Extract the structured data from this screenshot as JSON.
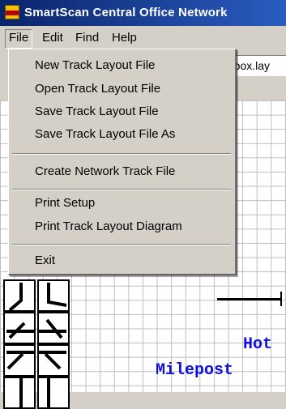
{
  "window": {
    "title": "SmartScan Central Office Network"
  },
  "menubar": {
    "file": "File",
    "edit": "Edit",
    "find": "Find",
    "help": "Help"
  },
  "file_menu": {
    "new_track": "New Track Layout File",
    "open_track": "Open Track Layout File",
    "save_track": "Save Track Layout File",
    "save_track_as": "Save Track Layout File As",
    "create_network": "Create Network Track File",
    "print_setup": "Print Setup",
    "print_diagram": "Print Track Layout Diagram",
    "exit": "Exit"
  },
  "toolbar": {
    "filename": "otbox.lay"
  },
  "canvas": {
    "hot_label": "Hot",
    "milepost_label": "Milepost"
  },
  "colors": {
    "title_bar": "#0a246a",
    "label_blue": "#1010e0",
    "menu_bg": "#d4d0c8"
  }
}
